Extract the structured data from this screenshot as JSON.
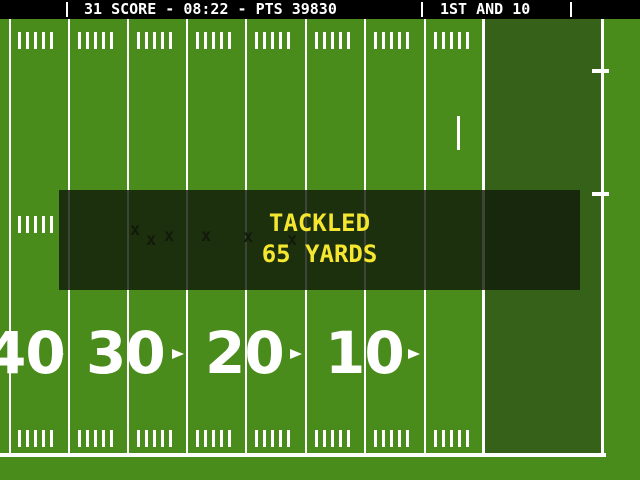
{
  "scoreboard": {
    "left_text": "31 SCORE - 08:22 - PTS 39830",
    "right_text": "1ST AND 10"
  },
  "field": {
    "yard_numbers": [
      "40",
      "30",
      "20",
      "10"
    ],
    "players": [
      "x",
      "x",
      "x",
      "x",
      "x",
      "x"
    ],
    "colors": {
      "grass": "#4a8c1c",
      "endzone": "#356218",
      "lines": "#ffffff"
    }
  },
  "message": {
    "line1": "TACKLED",
    "line2": "65 YARDS",
    "color": "#f5e72f"
  }
}
